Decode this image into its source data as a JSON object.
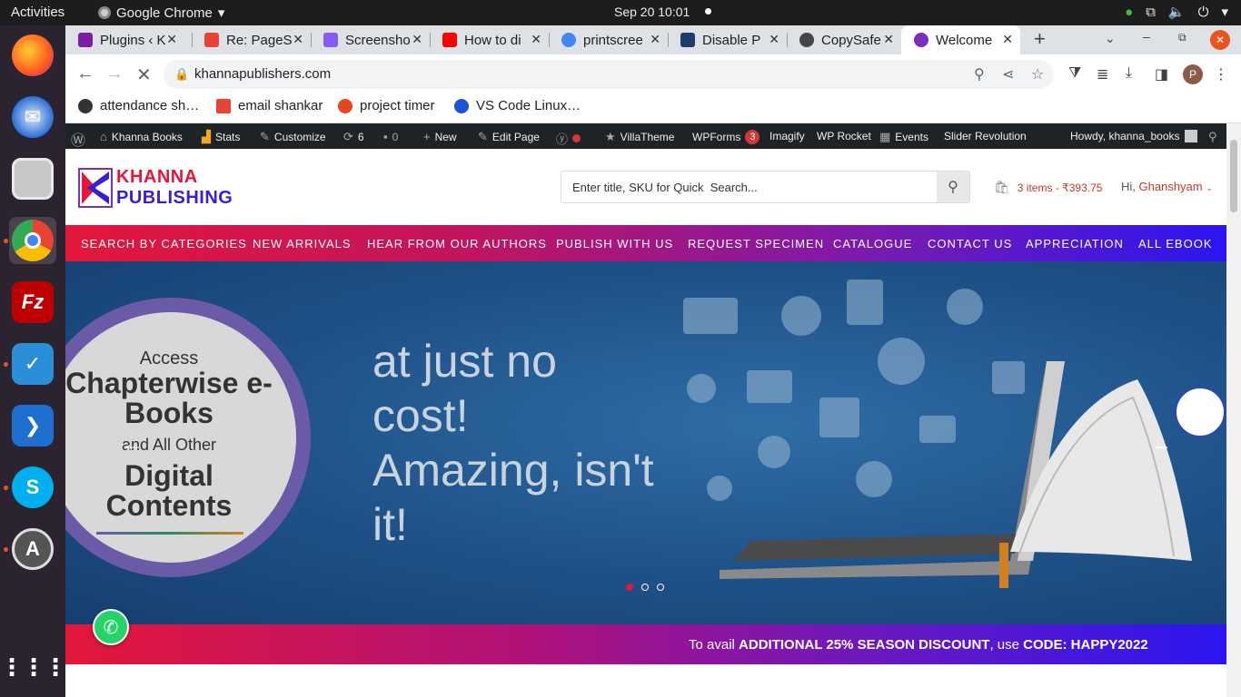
{
  "system": {
    "activities": "Activities",
    "app_name": "Google Chrome",
    "clock": "Sep 20  10:01"
  },
  "tabs": [
    {
      "title": "Plugins ‹ K",
      "color": "#7a1fa2"
    },
    {
      "title": "Re: PageS",
      "color": "#ea4335"
    },
    {
      "title": "Screensho",
      "color": "#8a5cf6"
    },
    {
      "title": "How to di",
      "color": "#ff0000"
    },
    {
      "title": "printscree",
      "color": "#4285f4"
    },
    {
      "title": "Disable P",
      "color": "#1a3d6d"
    },
    {
      "title": "CopySafe",
      "color": "#444444"
    },
    {
      "title": "Welcome",
      "color": "#7b2fbf"
    }
  ],
  "address": {
    "url": "khannapublishers.com"
  },
  "bookmarks": [
    {
      "label": "attendance sh…",
      "color": "#333333"
    },
    {
      "label": "email shankar",
      "color": "#ea4335"
    },
    {
      "label": "project timer",
      "color": "#e8451e"
    },
    {
      "label": "VS Code Linux…",
      "color": "#1a55d6"
    }
  ],
  "wp_admin": {
    "site": "Khanna Books",
    "stats": "Stats",
    "customize": "Customize",
    "updates": "6",
    "comments": "0",
    "new": "New",
    "edit_page": "Edit Page",
    "villatheme": "VillaTheme",
    "wpforms": "WPForms",
    "wpforms_count": "3",
    "imagify": "Imagify",
    "wp_rocket": "WP Rocket",
    "events": "Events",
    "slider_revolution": "Slider Revolution",
    "howdy": "Howdy, khanna_books"
  },
  "site": {
    "logo_line1": "KHANNA",
    "logo_line2": "PUBLISHING",
    "search_placeholder": "Enter title, SKU for Quick  Search...",
    "cart": "3 items - ₹393.75",
    "greeting": "Hi,",
    "user": "Ghanshyam",
    "nav": [
      "SEARCH BY CATEGORIES",
      "NEW ARRIVALS",
      "HEAR FROM OUR AUTHORS",
      "PUBLISH WITH US",
      "REQUEST SPECIMEN",
      "CATALOGUE",
      "CONTACT US",
      "APPRECIATION",
      "ALL EBOOK"
    ]
  },
  "hero": {
    "access": "Access",
    "line1": "Chapterwise e-Books",
    "line2": "and All Other",
    "line3": "Digital Contents",
    "tagline": "at just no cost! Amazing, isn't it!",
    "slides": 3,
    "active_slide": 1
  },
  "promo": {
    "pre": "To avail ",
    "highlight": "ADDITIONAL 25% SEASON DISCOUNT",
    "mid": ", use ",
    "code": "CODE: HAPPY2022"
  },
  "colors": {
    "brand_red": "#e3173a",
    "brand_blue": "#2b16f0",
    "brand_purple": "#7b2fbf"
  }
}
